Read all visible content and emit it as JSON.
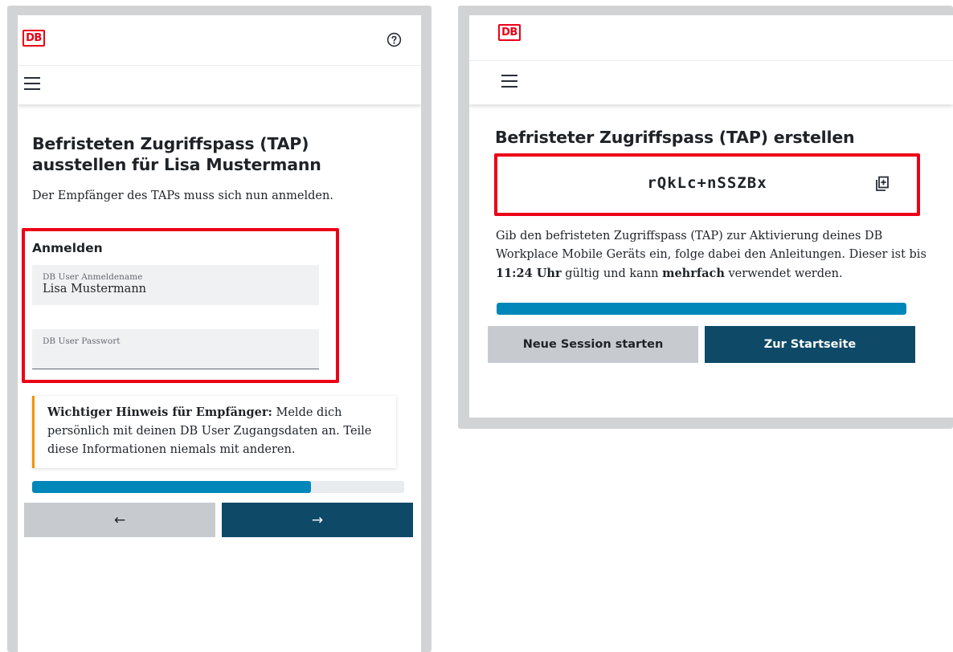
{
  "left_screen": {
    "logo": "DB",
    "help_icon": "question-circle-icon",
    "menu_icon": "hamburger-icon",
    "title": "Befristeten Zugriffspass (TAP) ausstellen für Lisa Mustermann",
    "subtitle": "Der Empfänger des TAPs muss sich nun anmelden.",
    "login": {
      "heading": "Anmelden",
      "username_label": "DB User Anmeldename",
      "username_value": "Lisa Mustermann",
      "password_label": "DB User Passwort",
      "password_value": ""
    },
    "notice": {
      "bold": "Wichtiger Hinweis für Empfänger:",
      "text": " Melde dich persönlich mit deinen DB User Zugangsdaten an. Teile diese Informationen niemals mit anderen."
    },
    "progress": 0.75,
    "back_button": "←",
    "next_button": "→"
  },
  "right_screen": {
    "logo": "DB",
    "menu_icon": "hamburger-icon",
    "title": "Befristeter Zugriffspass (TAP) erstellen",
    "tap_code": "rQkLc+nSSZBx",
    "copy_icon": "copy-icon",
    "info": {
      "part1": "Gib den befristeten Zugriffspass (TAP) zur Aktivierung deines DB Workplace Mobile Geräts ein, folge dabei den Anleitungen. Dieser ist bis ",
      "time": "11:24 Uhr",
      "part2": " gültig und kann ",
      "bold2": "mehrfach",
      "part3": " verwendet werden."
    },
    "progress": 1.0,
    "secondary_button": "Neue Session starten",
    "primary_button": "Zur Startseite"
  },
  "colors": {
    "db_red": "#ec0016",
    "progress_blue": "#0087b9",
    "primary_button": "#0e4a68",
    "secondary_button": "#c7cbcf",
    "notice_accent": "#f39200"
  }
}
